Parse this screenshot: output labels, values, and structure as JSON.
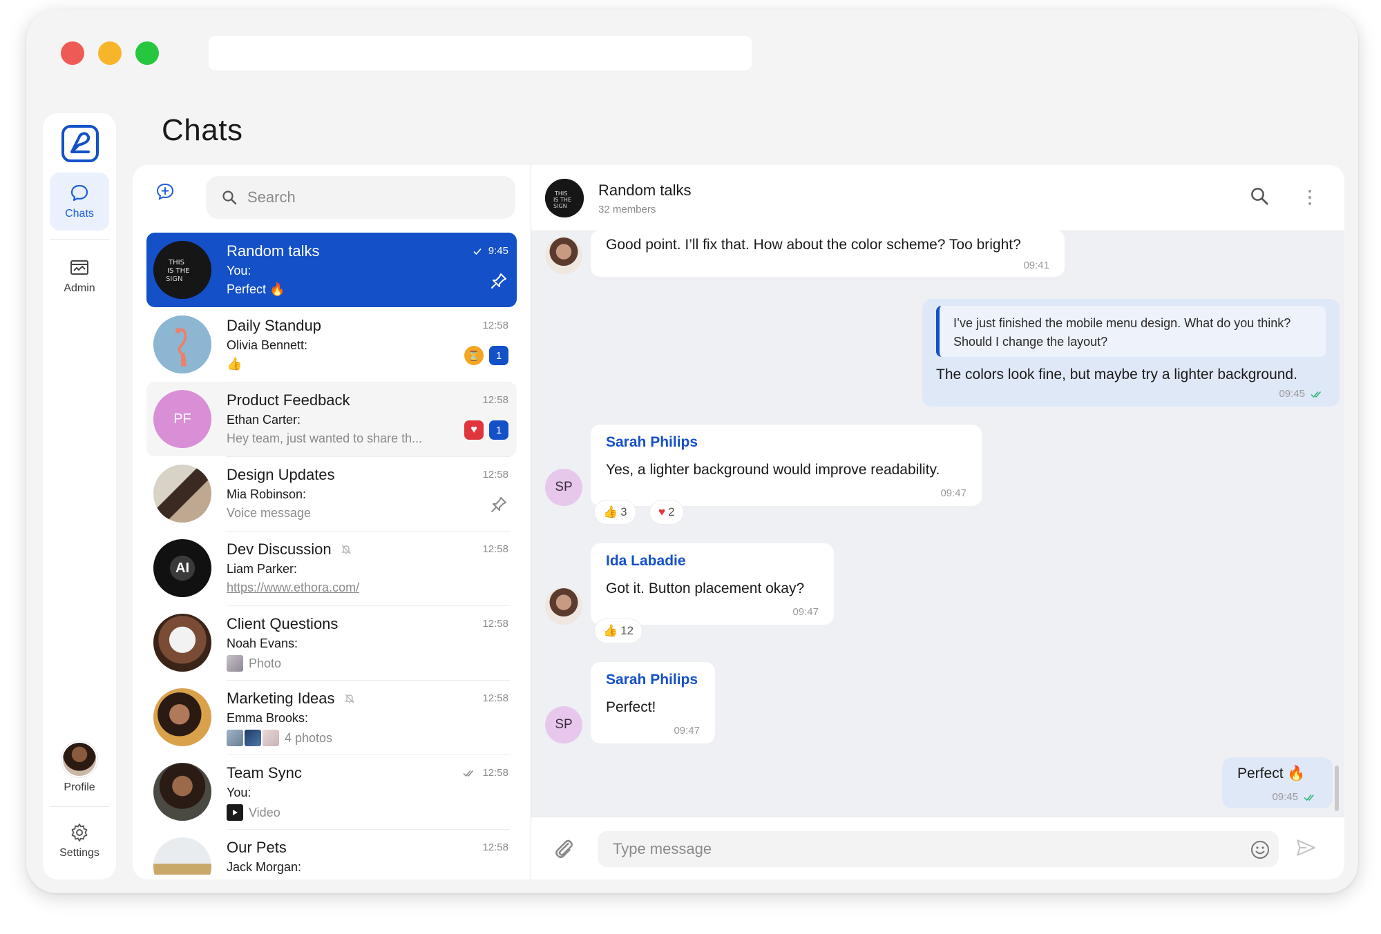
{
  "app": {
    "page_title": "Chats",
    "accent": "#1450C8"
  },
  "rail": {
    "items": [
      {
        "label": "Chats",
        "icon": "chat-bubble-icon"
      },
      {
        "label": "Admin",
        "icon": "admin-icon"
      },
      {
        "label": "Profile",
        "icon": "profile-avatar"
      },
      {
        "label": "Settings",
        "icon": "gear-icon"
      }
    ]
  },
  "list": {
    "search_placeholder": "Search",
    "chats": [
      {
        "name": "Random talks",
        "sender": "You:",
        "preview": "Perfect 🔥",
        "time": "9:45",
        "status": "read-single",
        "pinned": true,
        "selected": true
      },
      {
        "name": "Daily Standup",
        "sender": "Olivia Bennett:",
        "preview": "👍",
        "time": "12:58",
        "reaction": "⏳",
        "unread": "1"
      },
      {
        "name": "Product Feedback",
        "initials": "PF",
        "sender": "Ethan Carter:",
        "preview": "Hey team, just wanted to share th...",
        "time": "12:58",
        "reaction": "♥",
        "unread": "1"
      },
      {
        "name": "Design Updates",
        "sender": "Mia Robinson:",
        "preview": "Voice message",
        "time": "12:58",
        "pinned": true
      },
      {
        "name": "Dev Discussion",
        "sender": "Liam Parker:",
        "preview": "https://www.ethora.com/",
        "time": "12:58",
        "muted": true,
        "avatar_text": "AI"
      },
      {
        "name": "Client Questions",
        "sender": "Noah Evans:",
        "preview": "Photo",
        "time": "12:58"
      },
      {
        "name": "Marketing Ideas",
        "sender": "Emma Brooks:",
        "preview": "4 photos",
        "time": "12:58",
        "muted": true
      },
      {
        "name": "Team Sync",
        "sender": "You:",
        "preview": "Video",
        "time": "12:58",
        "status": "read-double"
      },
      {
        "name": "Our Pets",
        "sender": "Jack Morgan:",
        "preview": "",
        "time": "12:58"
      }
    ]
  },
  "conversation": {
    "title": "Random talks",
    "subtitle": "32 members",
    "messages": [
      {
        "text": "Good point. I’ll fix that. How about the color scheme? Too bright?",
        "time": "09:41"
      },
      {
        "quote": "I’ve just finished the mobile menu design. What do you think? Should I change the layout?",
        "text": "The colors look fine, but maybe try a lighter background.",
        "time": "09:45",
        "own": true
      },
      {
        "author": "Sarah Philips",
        "initials": "SP",
        "text": "Yes, a lighter background would improve readability.",
        "time": "09:47",
        "reactions": [
          {
            "emoji": "👍",
            "count": "3"
          },
          {
            "emoji": "♥",
            "count": "2"
          }
        ]
      },
      {
        "author": "Ida Labadie",
        "text": "Got it. Button placement okay?",
        "time": "09:47",
        "reactions": [
          {
            "emoji": "👍",
            "count": "12"
          }
        ]
      },
      {
        "author": "Sarah Philips",
        "initials": "SP",
        "text": "Perfect!",
        "time": "09:47"
      },
      {
        "text": "Perfect 🔥",
        "time": "09:45",
        "own": true
      }
    ],
    "composer_placeholder": "Type message"
  }
}
